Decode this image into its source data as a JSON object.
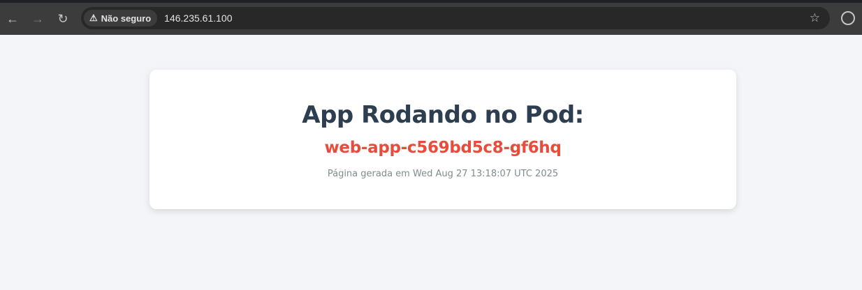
{
  "browser": {
    "security_label": "Não seguro",
    "url": "146.235.61.100"
  },
  "page": {
    "title": "App Rodando no Pod:",
    "pod_name": "web-app-c569bd5c8-gf6hq",
    "generated": "Página gerada em Wed Aug 27 13:18:07 UTC 2025"
  },
  "colors": {
    "title": "#2c3e50",
    "pod": "#e74c3c",
    "meta": "#7f8c8d"
  }
}
